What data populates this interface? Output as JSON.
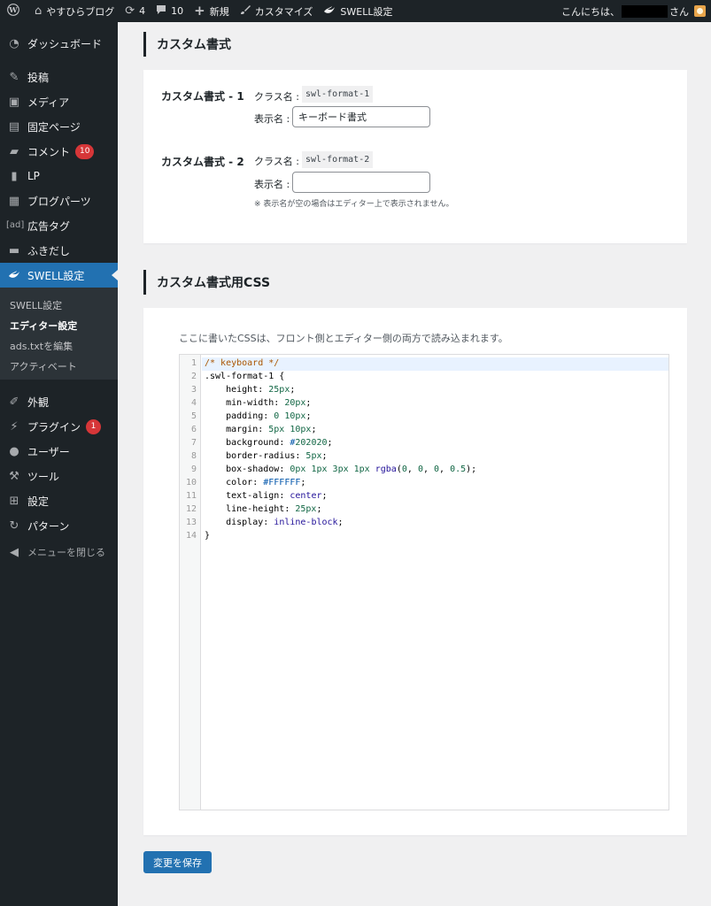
{
  "adminbar": {
    "site_name": "やすひらブログ",
    "updates_count": "4",
    "comments_count": "10",
    "new_label": "新規",
    "customize_label": "カスタマイズ",
    "swell_label": "SWELL設定",
    "greeting": "こんにちは、",
    "greeting_suffix": "さん"
  },
  "sidebar": {
    "dashboard": "ダッシュボード",
    "posts": "投稿",
    "media": "メディア",
    "pages": "固定ページ",
    "comments": "コメント",
    "comments_badge": "10",
    "lp": "LP",
    "blog_parts": "ブログパーツ",
    "ad_tag": "広告タグ",
    "ad_icon_text": "[ad]",
    "balloon": "ふきだし",
    "swell_settings": "SWELL設定",
    "sub_swell": "SWELL設定",
    "sub_editor": "エディター設定",
    "sub_ads": "ads.txtを編集",
    "sub_activate": "アクティベート",
    "appearance": "外観",
    "plugins": "プラグイン",
    "plugins_badge": "1",
    "users": "ユーザー",
    "tools": "ツール",
    "settings": "設定",
    "patterns": "パターン",
    "collapse": "メニューを閉じる"
  },
  "section1": {
    "heading": "カスタム書式",
    "format1": {
      "label": "カスタム書式 - 1",
      "class_label": "クラス名 :",
      "class_value": "swl-format-1",
      "display_label": "表示名 :",
      "display_value": "キーボード書式"
    },
    "format2": {
      "label": "カスタム書式 - 2",
      "class_label": "クラス名 :",
      "class_value": "swl-format-2",
      "display_label": "表示名 :",
      "display_value": ""
    },
    "note": "※ 表示名が空の場合はエディター上で表示されません。"
  },
  "section2": {
    "heading": "カスタム書式用CSS",
    "description": "ここに書いたCSSは、フロント側とエディター側の両方で読み込まれます。"
  },
  "css_code": [
    "/* keyboard */",
    ".swl-format-1 {",
    "    height: 25px;",
    "    min-width: 20px;",
    "    padding: 0 10px;",
    "    margin: 5px 10px;",
    "    background: #202020;",
    "    border-radius: 5px;",
    "    box-shadow: 0px 1px 3px 1px rgba(0, 0, 0, 0.5);",
    "    color: #FFFFFF;",
    "    text-align: center;",
    "    line-height: 25px;",
    "    display: inline-block;",
    "}"
  ],
  "save_button": "変更を保存",
  "colors": {
    "admin_dark": "#1d2327",
    "accent": "#2271b1",
    "badge": "#d63638",
    "background": "#f0f0f1"
  }
}
